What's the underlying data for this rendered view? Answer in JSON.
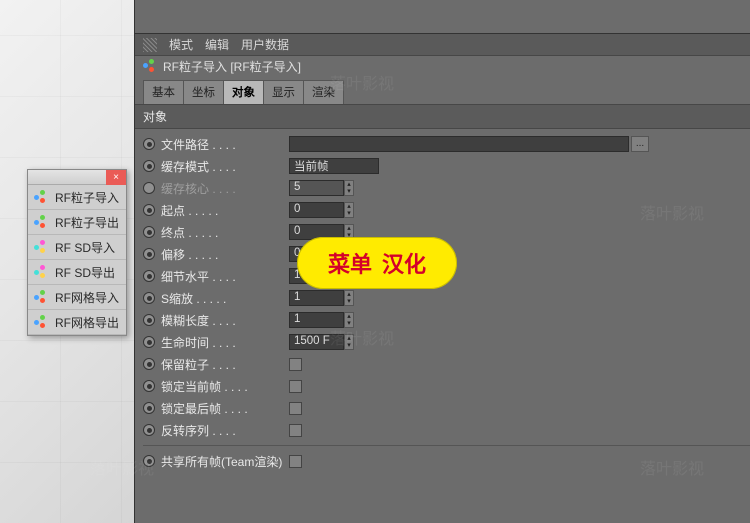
{
  "menubar": {
    "mode": "模式",
    "edit": "编辑",
    "userdata": "用户数据"
  },
  "object": {
    "icon": "particle-icon",
    "name": "RF粒子导入 [RF粒子导入]"
  },
  "tabs": [
    {
      "label": "基本",
      "active": false
    },
    {
      "label": "坐标",
      "active": false
    },
    {
      "label": "对象",
      "active": true
    },
    {
      "label": "显示",
      "active": false
    },
    {
      "label": "渲染",
      "active": false
    }
  ],
  "section": "对象",
  "props": [
    {
      "kind": "path",
      "label": "文件路径",
      "value": ""
    },
    {
      "kind": "text",
      "label": "缓存模式",
      "value": "当前帧"
    },
    {
      "kind": "num",
      "label": "缓存核心",
      "value": "5",
      "disabled": true
    },
    {
      "kind": "num",
      "label": "起点",
      "value": "0"
    },
    {
      "kind": "num",
      "label": "终点",
      "value": "0"
    },
    {
      "kind": "num",
      "label": "偏移",
      "value": "0"
    },
    {
      "kind": "num",
      "label": "细节水平",
      "value": "10"
    },
    {
      "kind": "num",
      "label": "S缩放",
      "value": "1"
    },
    {
      "kind": "num",
      "label": "模糊长度",
      "value": "1"
    },
    {
      "kind": "num",
      "label": "生命时间",
      "value": "1500 F"
    },
    {
      "kind": "check",
      "label": "保留粒子"
    },
    {
      "kind": "check",
      "label": "锁定当前帧"
    },
    {
      "kind": "check",
      "label": "锁定最后帧"
    },
    {
      "kind": "check",
      "label": "反转序列"
    },
    {
      "kind": "hr"
    },
    {
      "kind": "check",
      "label": "共享所有帧(Team渲染)"
    }
  ],
  "floatmenu": {
    "close": "×",
    "items": [
      {
        "label": "RF粒子导入",
        "scheme": "rgb"
      },
      {
        "label": "RF粒子导出",
        "scheme": "rgb"
      },
      {
        "label": "RF SD导入",
        "scheme": "cmy"
      },
      {
        "label": "RF SD导出",
        "scheme": "cmy"
      },
      {
        "label": "RF网格导入",
        "scheme": "rgb"
      },
      {
        "label": "RF网格导出",
        "scheme": "rgb"
      }
    ]
  },
  "badge": {
    "a": "菜单",
    "b": "汉化"
  },
  "watermark": "落叶影视",
  "buttons": {
    "browse": "..."
  }
}
